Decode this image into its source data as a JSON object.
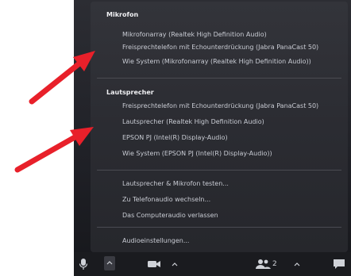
{
  "mic": {
    "title": "Mikrofon",
    "items": [
      {
        "label": "Mikrofonarray (Realtek High Definition Audio)",
        "checked": false
      },
      {
        "label": "Freisprechtelefon mit Echounterdrückung (Jabra PanaCast 50)",
        "checked": true
      },
      {
        "label": "Wie System (Mikrofonarray (Realtek High Definition Audio))",
        "checked": false
      }
    ]
  },
  "speaker": {
    "title": "Lautsprecher",
    "items": [
      {
        "label": "Freisprechtelefon mit Echounterdrückung (Jabra PanaCast 50)",
        "checked": true
      },
      {
        "label": "Lautsprecher (Realtek High Definition Audio)",
        "checked": false
      },
      {
        "label": "EPSON PJ (Intel(R) Display-Audio)",
        "checked": false
      },
      {
        "label": "Wie System (EPSON PJ (Intel(R) Display-Audio))",
        "checked": false
      }
    ]
  },
  "actions": [
    {
      "label": "Lautsprecher & Mikrofon testen..."
    },
    {
      "label": "Zu Telefonaudio wechseln..."
    },
    {
      "label": "Das Computeraudio verlassen"
    }
  ],
  "settings": {
    "label": "Audioeinstellungen..."
  },
  "toolbar": {
    "mic_icon": "microphone-icon",
    "video_icon": "video-camera-icon",
    "participants_icon": "participants-icon",
    "participants_count": "2",
    "chat_icon": "chat-icon",
    "check_glyph": "✓"
  },
  "colors": {
    "arrow": "#e8202a",
    "menu_bg": "#2e2f35"
  }
}
